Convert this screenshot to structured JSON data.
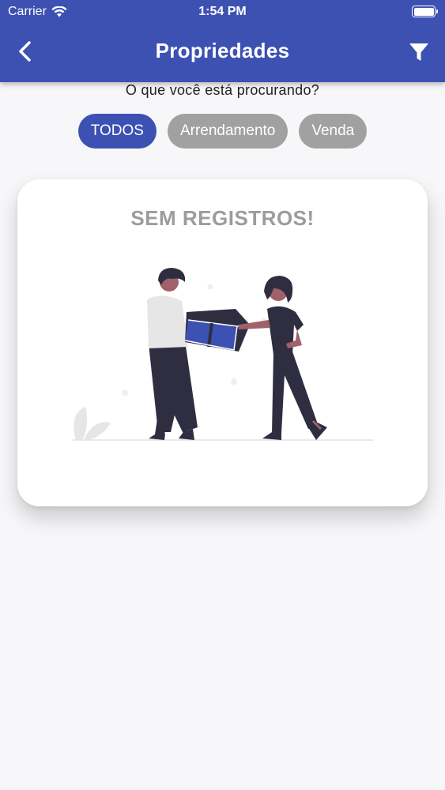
{
  "status_bar": {
    "carrier": "Carrier",
    "time": "1:54 PM"
  },
  "header": {
    "title": "Propriedades",
    "back_icon": "chevron-left-icon",
    "filter_icon": "filter-icon",
    "color": "#3d51b3"
  },
  "search": {
    "question": "O que você está procurando?"
  },
  "filters": {
    "options": [
      "TODOS",
      "Arrendamento",
      "Venda"
    ],
    "selected": "TODOS",
    "active_color": "#3d51b3",
    "inactive_color": "#a1a1a1"
  },
  "empty_state": {
    "message": "SEM REGISTROS!",
    "illustration": "two-people-delivering-box-illustration"
  }
}
